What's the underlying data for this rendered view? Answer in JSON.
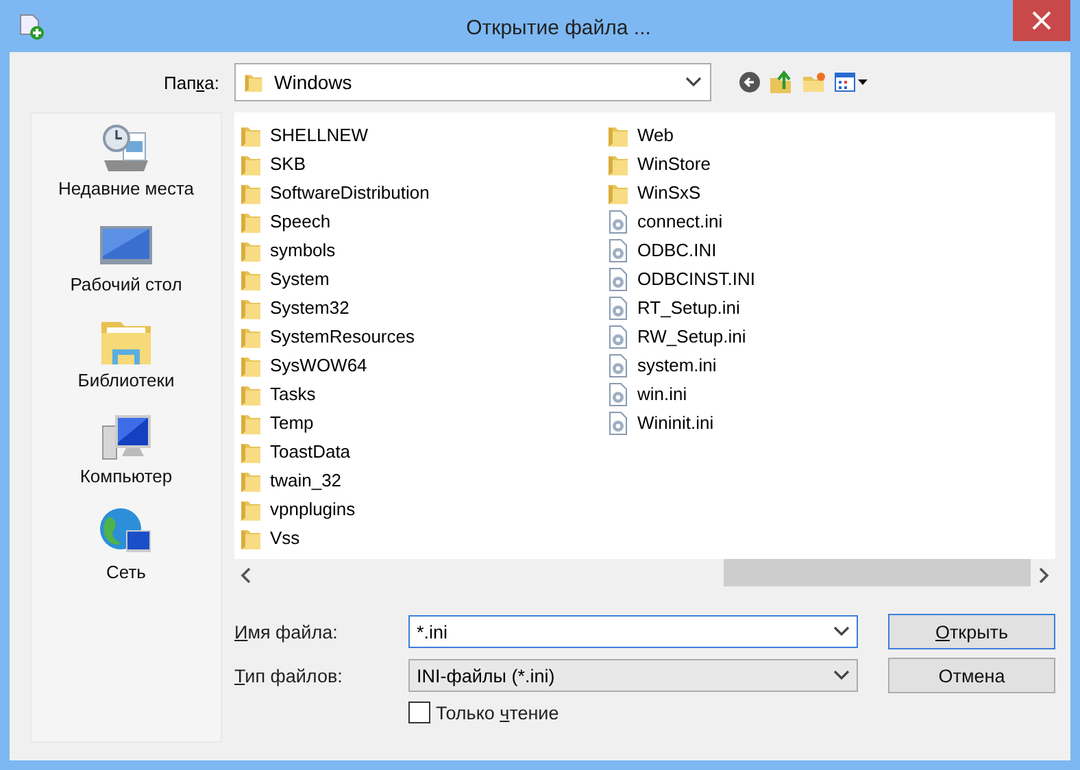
{
  "window": {
    "title": "Открытие файла ..."
  },
  "toolbar": {
    "folder_label": {
      "before": "Пап",
      "key": "к",
      "after": "а:"
    },
    "folder": "Windows"
  },
  "sidebar": {
    "items": [
      {
        "label": "Недавние места",
        "kind": "recent"
      },
      {
        "label": "Рабочий стол",
        "kind": "desktop"
      },
      {
        "label": "Библиотеки",
        "kind": "libraries"
      },
      {
        "label": "Компьютер",
        "kind": "computer"
      },
      {
        "label": "Сеть",
        "kind": "network"
      }
    ]
  },
  "files": [
    {
      "name": "SHELLNEW",
      "kind": "folder"
    },
    {
      "name": "SKB",
      "kind": "folder"
    },
    {
      "name": "SoftwareDistribution",
      "kind": "folder"
    },
    {
      "name": "Speech",
      "kind": "folder"
    },
    {
      "name": "symbols",
      "kind": "folder"
    },
    {
      "name": "System",
      "kind": "folder"
    },
    {
      "name": "System32",
      "kind": "folder"
    },
    {
      "name": "SystemResources",
      "kind": "folder"
    },
    {
      "name": "SysWOW64",
      "kind": "folder"
    },
    {
      "name": "Tasks",
      "kind": "folder"
    },
    {
      "name": "Temp",
      "kind": "folder"
    },
    {
      "name": "ToastData",
      "kind": "folder"
    },
    {
      "name": "twain_32",
      "kind": "folder"
    },
    {
      "name": "vpnplugins",
      "kind": "folder"
    },
    {
      "name": "Vss",
      "kind": "folder"
    },
    {
      "name": "Web",
      "kind": "folder"
    },
    {
      "name": "WinStore",
      "kind": "folder"
    },
    {
      "name": "WinSxS",
      "kind": "folder"
    },
    {
      "name": "connect.ini",
      "kind": "ini"
    },
    {
      "name": "ODBC.INI",
      "kind": "ini"
    },
    {
      "name": "ODBCINST.INI",
      "kind": "ini"
    },
    {
      "name": "RT_Setup.ini",
      "kind": "ini"
    },
    {
      "name": "RW_Setup.ini",
      "kind": "ini"
    },
    {
      "name": "system.ini",
      "kind": "ini"
    },
    {
      "name": "win.ini",
      "kind": "ini"
    },
    {
      "name": "Wininit.ini",
      "kind": "ini"
    }
  ],
  "form": {
    "file_name": {
      "label": {
        "key": "И",
        "after": "мя файла:"
      },
      "value": "*.ini"
    },
    "file_type": {
      "label": {
        "key": "Т",
        "after": "ип файлов:"
      },
      "value": "INI-файлы (*.ini)"
    },
    "read_only": {
      "label": {
        "before": "Только ",
        "key": "ч",
        "after": "тение"
      },
      "checked": false
    },
    "open_button": {
      "key": "О",
      "after": "ткрыть"
    },
    "cancel_button": "Отмена"
  }
}
